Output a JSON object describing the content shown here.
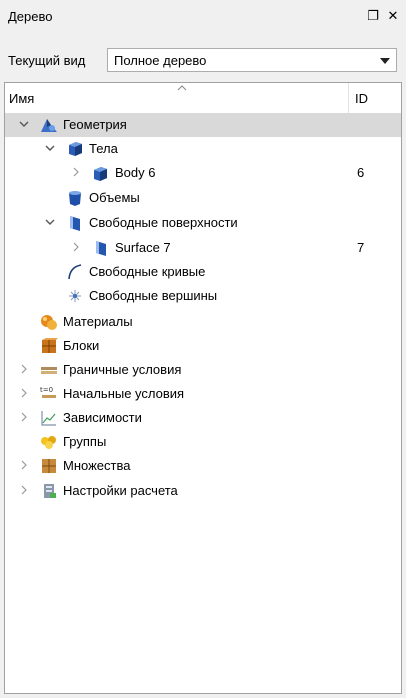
{
  "panel": {
    "title": "Дерево",
    "float_glyph": "❐",
    "close_glyph": "✕"
  },
  "view": {
    "label": "Текущий вид",
    "selected": "Полное дерево"
  },
  "columns": {
    "name": "Имя",
    "id": "ID"
  },
  "tree": [
    {
      "label": "Геометрия",
      "id": "",
      "icon": "geometry-icon",
      "state": "expanded",
      "selected": true
    },
    {
      "label": "Тела",
      "id": "",
      "icon": "bodies-icon",
      "state": "expanded"
    },
    {
      "label": "Body 6",
      "id": "6",
      "icon": "body-icon",
      "state": "collapsed"
    },
    {
      "label": "Объемы",
      "id": "",
      "icon": "volumes-icon",
      "state": "leaf"
    },
    {
      "label": "Свободные поверхности",
      "id": "",
      "icon": "surfaces-icon",
      "state": "expanded"
    },
    {
      "label": "Surface 7",
      "id": "7",
      "icon": "surface-icon",
      "state": "collapsed"
    },
    {
      "label": "Свободные кривые",
      "id": "",
      "icon": "curves-icon",
      "state": "leaf"
    },
    {
      "label": "Свободные вершины",
      "id": "",
      "icon": "vertices-icon",
      "state": "leaf"
    },
    {
      "label": "Материалы",
      "id": "",
      "icon": "materials-icon",
      "state": "leaf"
    },
    {
      "label": "Блоки",
      "id": "",
      "icon": "blocks-icon",
      "state": "leaf"
    },
    {
      "label": "Граничные условия",
      "id": "",
      "icon": "boundary-conditions-icon",
      "state": "collapsed"
    },
    {
      "label": "Начальные условия",
      "id": "",
      "icon": "initial-conditions-icon",
      "state": "collapsed",
      "icon_text": "t=0"
    },
    {
      "label": "Зависимости",
      "id": "",
      "icon": "dependencies-icon",
      "state": "collapsed"
    },
    {
      "label": "Группы",
      "id": "",
      "icon": "groups-icon",
      "state": "leaf"
    },
    {
      "label": "Множества",
      "id": "",
      "icon": "sets-icon",
      "state": "collapsed"
    },
    {
      "label": "Настройки расчета",
      "id": "",
      "icon": "solver-settings-icon",
      "state": "collapsed"
    }
  ]
}
